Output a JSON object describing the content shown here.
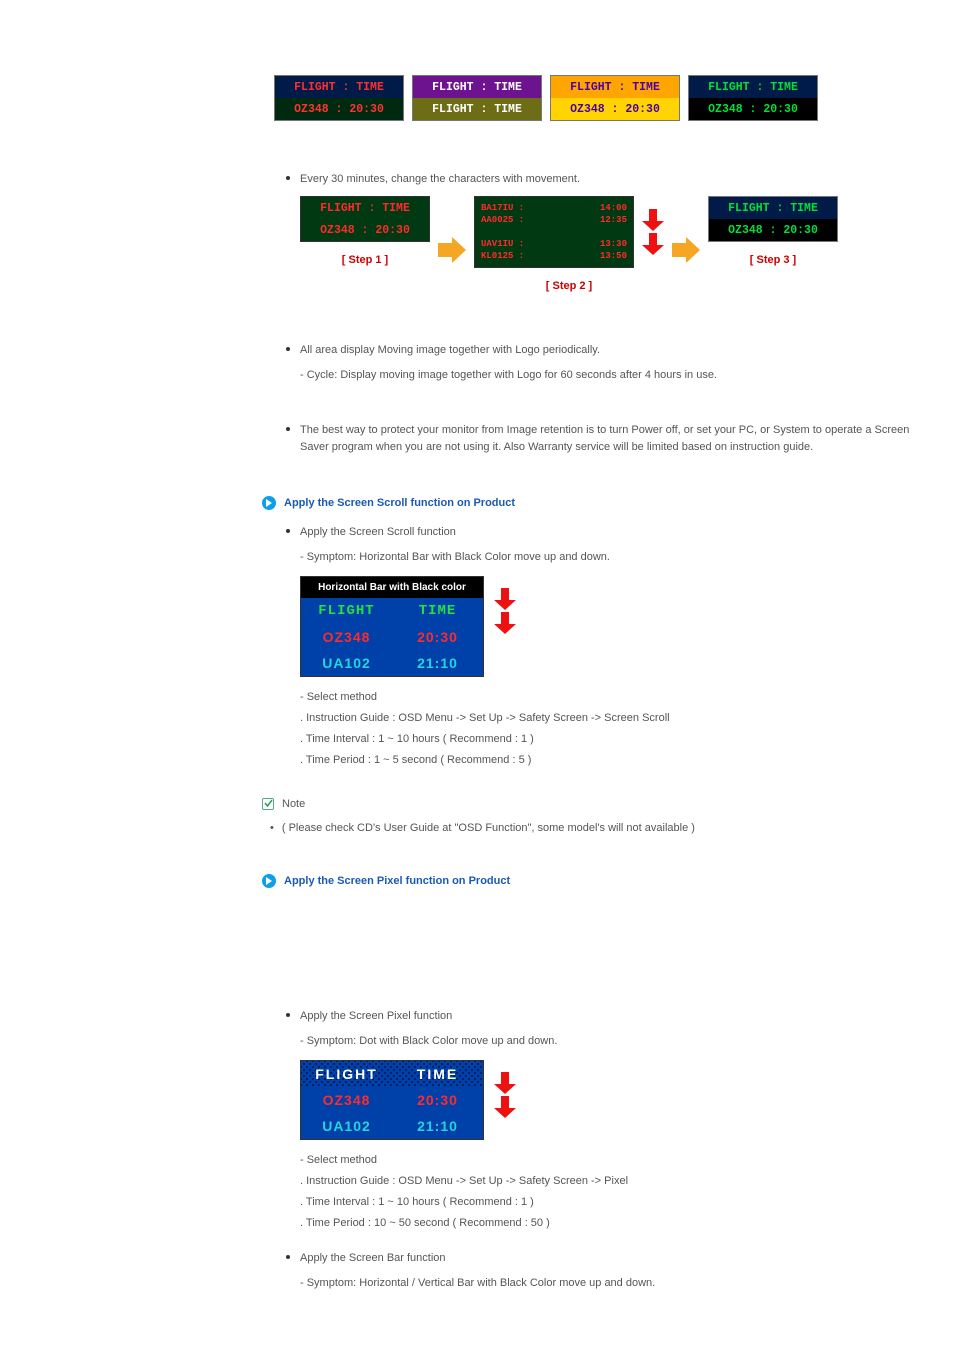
{
  "card_header": "FLIGHT : TIME",
  "card_body": "OZ348   : 20:30",
  "step3_body": "OZ348  :  20:30",
  "scram": {
    "l1a": "BA17IU :",
    "l1b": "14:00",
    "l2a": "AA0025 :",
    "l2b": "12:35",
    "l3a": "UAV1IU :",
    "l3b": "13:30",
    "l4a": "KL0125 :",
    "l4b": "13:50"
  },
  "bullets": {
    "b1": "Every 30 minutes, change the characters with movement.",
    "b2": "All area display Moving image together with Logo periodically.",
    "b2_sub": "- Cycle: Display moving image together with Logo for 60 seconds after 4 hours in use.",
    "b3": "The best way to protect your monitor from Image retention is to turn Power off, or set your PC, or System to operate a Screen Saver program when you are not using it. Also Warranty service will be limited based on instruction guide."
  },
  "steps": {
    "s1": "[ Step 1 ]",
    "s2": "[ Step 2 ]",
    "s3": "[ Step 3 ]"
  },
  "section_scroll": {
    "title": "Apply the Screen Scroll function on Product",
    "bullet": "Apply the Screen Scroll function",
    "symptom": "- Symptom: Horizontal Bar with Black Color move up and down.",
    "caption": "Horizontal Bar with Black color",
    "hcell1": "FLIGHT",
    "hcell2": "TIME",
    "r2c1": "OZ348",
    "r2c2": "20:30",
    "r3c1": "UA102",
    "r3c2": "21:10",
    "select": "- Select method",
    "m1": ". Instruction Guide : OSD Menu -> Set Up -> Safety Screen -> Screen Scroll",
    "m2": ". Time Interval : 1 ~ 10 hours ( Recommend : 1 )",
    "m3": ". Time Period : 1 ~ 5 second ( Recommend : 5 )"
  },
  "note": {
    "label": "Note",
    "text": "( Please check CD's User Guide at \"OSD Function\", some model's will not available )"
  },
  "section_pixel": {
    "title": "Apply the Screen Pixel function on Product",
    "bullet": "Apply the Screen Pixel function",
    "symptom": "- Symptom: Dot with Black Color move up and down.",
    "hcell1": "FLIGHT",
    "hcell2": "TIME",
    "r2c1": "OZ348",
    "r2c2": "20:30",
    "r3c1": "UA102",
    "r3c2": "21:10",
    "select": "- Select method",
    "m1": ". Instruction Guide : OSD Menu -> Set Up -> Safety Screen -> Pixel",
    "m2": ". Time Interval : 1 ~ 10 hours ( Recommend : 1 )",
    "m3": ". Time Period : 10 ~ 50 second ( Recommend : 50 )"
  },
  "section_bar": {
    "bullet": "Apply the Screen Bar function",
    "symptom": "- Symptom: Horizontal / Vertical Bar with Black Color move up and down."
  }
}
